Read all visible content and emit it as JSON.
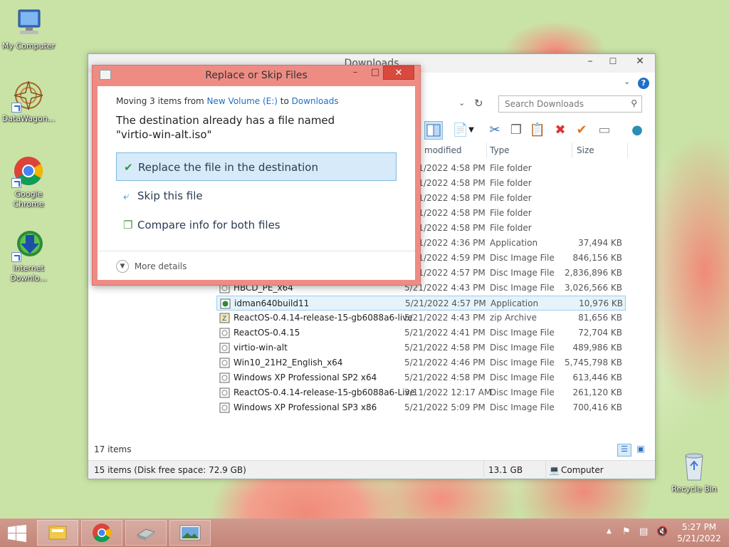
{
  "desktop": {
    "icons": [
      {
        "label": "My Computer"
      },
      {
        "label": "DataWagon..."
      },
      {
        "label": "Google Chrome"
      },
      {
        "label": "Internet Downlo..."
      },
      {
        "label": "Recycle Bin"
      }
    ]
  },
  "explorer": {
    "title": "Downloads",
    "search_placeholder": "Search Downloads",
    "columns": {
      "date": "modified",
      "type": "Type",
      "size": "Size"
    },
    "rows": [
      {
        "name": "",
        "date": "5/21/2022 4:58 PM",
        "type": "File folder",
        "size": ""
      },
      {
        "name": "",
        "date": "5/21/2022 4:58 PM",
        "type": "File folder",
        "size": ""
      },
      {
        "name": "",
        "date": "5/21/2022 4:58 PM",
        "type": "File folder",
        "size": ""
      },
      {
        "name": "",
        "date": "5/21/2022 4:58 PM",
        "type": "File folder",
        "size": ""
      },
      {
        "name": "",
        "date": "5/21/2022 4:58 PM",
        "type": "File folder",
        "size": ""
      },
      {
        "name": "",
        "date": "5/21/2022 4:36 PM",
        "type": "Application",
        "size": "37,494 KB"
      },
      {
        "name": "",
        "date": "5/21/2022 4:59 PM",
        "type": "Disc Image File",
        "size": "846,156 KB"
      },
      {
        "name": "",
        "date": "5/21/2022 4:57 PM",
        "type": "Disc Image File",
        "size": "2,836,896 KB"
      },
      {
        "name": "HBCD_PE_x64",
        "date": "5/21/2022 4:43 PM",
        "type": "Disc Image File",
        "size": "3,026,566 KB"
      },
      {
        "name": "idman640build11",
        "date": "5/21/2022 4:57 PM",
        "type": "Application",
        "size": "10,976 KB"
      },
      {
        "name": "ReactOS-0.4.14-release-15-gb6088a6-live",
        "date": "5/21/2022 4:43 PM",
        "type": "zip Archive",
        "size": "81,656 KB"
      },
      {
        "name": "ReactOS-0.4.15",
        "date": "5/21/2022 4:41 PM",
        "type": "Disc Image File",
        "size": "72,704 KB"
      },
      {
        "name": "virtio-win-alt",
        "date": "5/21/2022 4:58 PM",
        "type": "Disc Image File",
        "size": "489,986 KB"
      },
      {
        "name": "Win10_21H2_English_x64",
        "date": "5/21/2022 4:46 PM",
        "type": "Disc Image File",
        "size": "5,745,798 KB"
      },
      {
        "name": "Windows XP Professional SP2 x64",
        "date": "5/21/2022 4:58 PM",
        "type": "Disc Image File",
        "size": "613,446 KB"
      },
      {
        "name": "ReactOS-0.4.14-release-15-gb6088a6-Live",
        "date": "3/11/2022 12:17 AM",
        "type": "Disc Image File",
        "size": "261,120 KB"
      },
      {
        "name": "Windows XP Professional SP3 x86",
        "date": "5/21/2022 5:09 PM",
        "type": "Disc Image File",
        "size": "700,416 KB"
      }
    ],
    "item_count": "17 items",
    "status_left": "15 items (Disk free space: 72.9 GB)",
    "status_size": "13.1 GB",
    "status_location": "Computer"
  },
  "dialog": {
    "title": "Replace or Skip Files",
    "moving_prefix": "Moving 3 items from ",
    "source": "New Volume (E:)",
    "moving_mid": " to ",
    "destination": "Downloads",
    "message_line1": "The destination already has a file named",
    "message_line2": "\"virtio-win-alt.iso\"",
    "option_replace": "Replace the file in the destination",
    "option_skip": "Skip this file",
    "option_compare": "Compare info for both files",
    "more_details": "More details"
  },
  "taskbar": {
    "time": "5:27 PM",
    "date": "5/21/2022"
  }
}
